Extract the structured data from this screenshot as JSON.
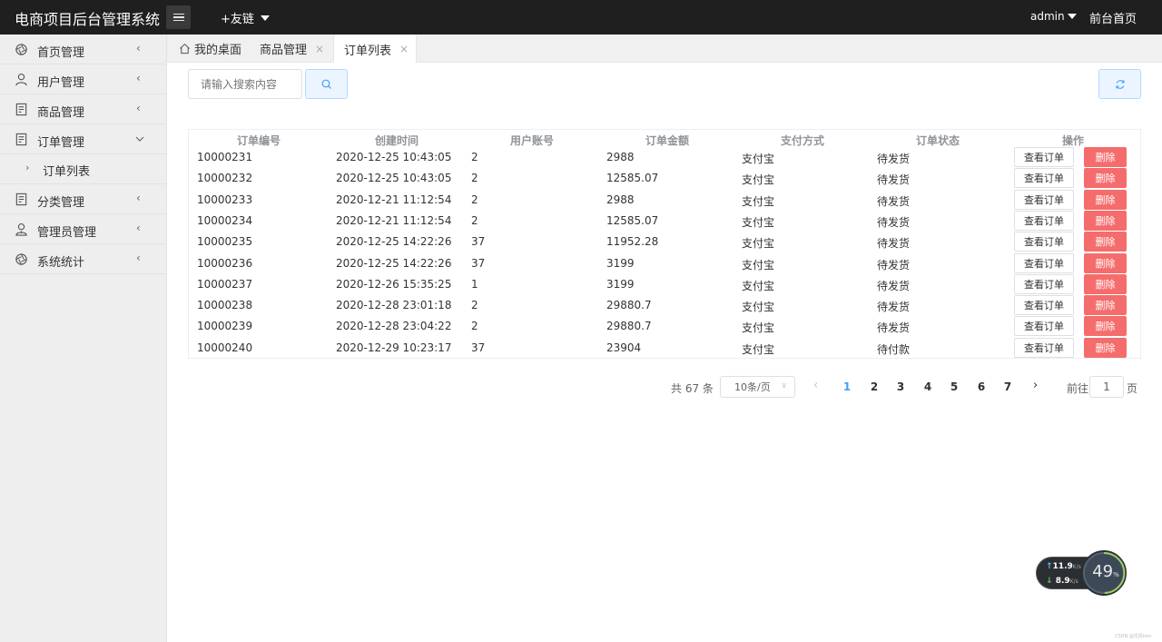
{
  "header": {
    "app_title": "电商项目后台管理系统",
    "friend_links": "+友链",
    "user": "admin",
    "front_home": "前台首页"
  },
  "sidebar": {
    "items": [
      {
        "label": "首页管理",
        "icon": "aperture-icon"
      },
      {
        "label": "用户管理",
        "icon": "user-icon"
      },
      {
        "label": "商品管理",
        "icon": "document-icon"
      },
      {
        "label": "订单管理",
        "icon": "document-icon",
        "expanded": true,
        "sub": "订单列表"
      },
      {
        "label": "分类管理",
        "icon": "document-icon"
      },
      {
        "label": "管理员管理",
        "icon": "admin-user-icon"
      },
      {
        "label": "系统统计",
        "icon": "aperture-icon"
      }
    ]
  },
  "tabs": [
    {
      "label": "我的桌面",
      "icon": "home-icon"
    },
    {
      "label": "商品管理",
      "close": "×"
    },
    {
      "label": "订单列表",
      "close": "×",
      "active": true
    }
  ],
  "search": {
    "placeholder": "请输入搜索内容"
  },
  "table": {
    "columns": [
      "订单编号",
      "创建时间",
      "用户账号",
      "订单金额",
      "支付方式",
      "订单状态",
      "操作"
    ],
    "view_label": "查看订单",
    "delete_label": "删除",
    "rows": [
      [
        "10000231",
        "2020-12-25 10:43:05",
        "2",
        "2988",
        "支付宝",
        "待发货"
      ],
      [
        "10000232",
        "2020-12-25 10:43:05",
        "2",
        "12585.07",
        "支付宝",
        "待发货"
      ],
      [
        "10000233",
        "2020-12-21 11:12:54",
        "2",
        "2988",
        "支付宝",
        "待发货"
      ],
      [
        "10000234",
        "2020-12-21 11:12:54",
        "2",
        "12585.07",
        "支付宝",
        "待发货"
      ],
      [
        "10000235",
        "2020-12-25 14:22:26",
        "37",
        "11952.28",
        "支付宝",
        "待发货"
      ],
      [
        "10000236",
        "2020-12-25 14:22:26",
        "37",
        "3199",
        "支付宝",
        "待发货"
      ],
      [
        "10000237",
        "2020-12-26 15:35:25",
        "1",
        "3199",
        "支付宝",
        "待发货"
      ],
      [
        "10000238",
        "2020-12-28 23:01:18",
        "2",
        "29880.7",
        "支付宝",
        "待发货"
      ],
      [
        "10000239",
        "2020-12-28 23:04:22",
        "2",
        "29880.7",
        "支付宝",
        "待发货"
      ],
      [
        "10000240",
        "2020-12-29 10:23:17",
        "37",
        "23904",
        "支付宝",
        "待付款"
      ]
    ]
  },
  "pagination": {
    "total": "共 67 条",
    "page_size": "10条/页",
    "pages": [
      "1",
      "2",
      "3",
      "4",
      "5",
      "6",
      "7"
    ],
    "current": "1",
    "goto_label": "前往",
    "goto_value": "1",
    "page_suffix": "页"
  },
  "net_widget": {
    "up": "11.9",
    "down": "8.9",
    "unit": "K/s",
    "percent": "49",
    "percent_sign": "%"
  },
  "watermark": "CSDN @沈风Iron",
  "colors": {
    "header_bg": "#1f1f1f",
    "primary": "#409eff",
    "danger": "#f56c6c"
  }
}
